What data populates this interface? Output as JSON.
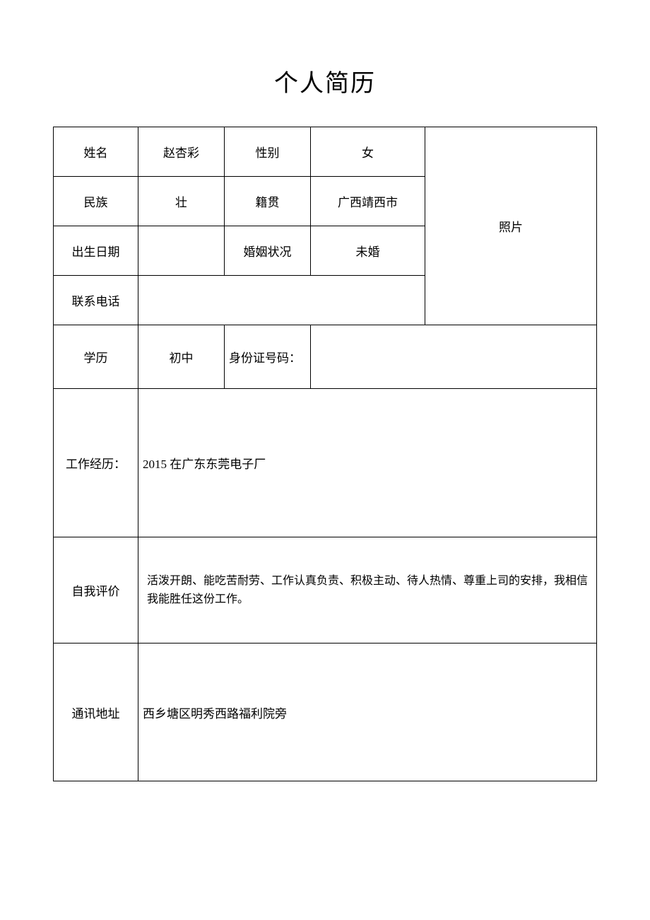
{
  "title": "个人简历",
  "labels": {
    "name": "姓名",
    "gender": "性别",
    "ethnicity": "民族",
    "origin": "籍贯",
    "birth": "出生日期",
    "marital": "婚姻状况",
    "phone": "联系电话",
    "photo": "照片",
    "education": "学历",
    "idnum": "身份证号码：",
    "work": "工作经历：",
    "selfeval": "自我评价",
    "address": "通讯地址"
  },
  "values": {
    "name": "赵杏彩",
    "gender": "女",
    "ethnicity": "壮",
    "origin": "广西靖西市",
    "birth": "",
    "marital": "未婚",
    "phone": "",
    "education": "初中",
    "idnum": "",
    "work": "2015 在广东东莞电子厂",
    "selfeval": "活泼开朗、能吃苦耐劳、工作认真负责、积极主动、待人热情、尊重上司的安排，我相信我能胜任这份工作。",
    "address": "西乡塘区明秀西路福利院旁"
  }
}
